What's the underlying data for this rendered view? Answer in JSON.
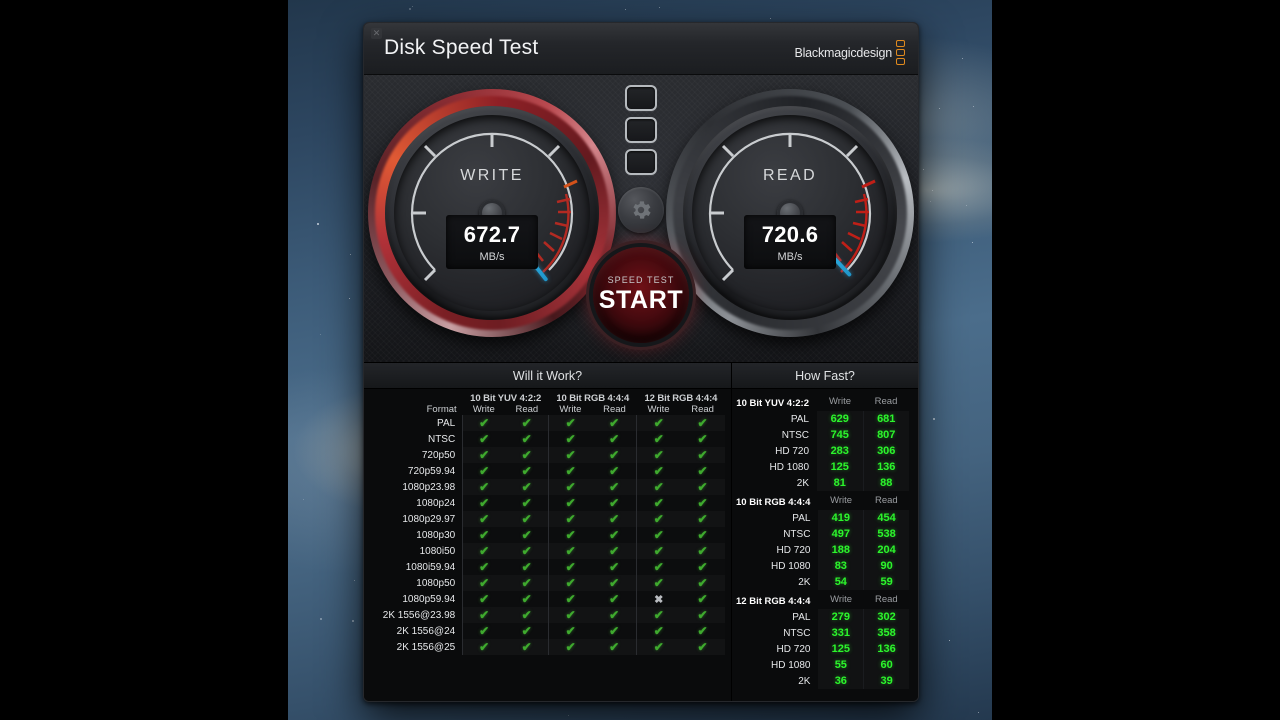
{
  "window": {
    "title": "Disk Speed Test",
    "close_icon": "close-icon",
    "brand": "Blackmagicdesign"
  },
  "gauges": {
    "write": {
      "label": "WRITE",
      "value": "672.7",
      "unit": "MB/s",
      "needle_deg": 52
    },
    "read": {
      "label": "READ",
      "value": "720.6",
      "unit": "MB/s",
      "needle_deg": 47
    }
  },
  "center": {
    "indicator_count": 3,
    "gear_icon": "gear-icon",
    "start_sub": "SPEED TEST",
    "start_main": "START"
  },
  "will_it_work": {
    "heading": "Will it Work?",
    "format_header": "Format",
    "groups": [
      {
        "label": "10 Bit YUV 4:2:2",
        "cols": [
          "Write",
          "Read"
        ]
      },
      {
        "label": "10 Bit RGB 4:4:4",
        "cols": [
          "Write",
          "Read"
        ]
      },
      {
        "label": "12 Bit RGB 4:4:4",
        "cols": [
          "Write",
          "Read"
        ]
      }
    ],
    "check_glyph": "✔",
    "cross_glyph": "✖",
    "rows": [
      {
        "format": "PAL",
        "cells": [
          true,
          true,
          true,
          true,
          true,
          true
        ]
      },
      {
        "format": "NTSC",
        "cells": [
          true,
          true,
          true,
          true,
          true,
          true
        ]
      },
      {
        "format": "720p50",
        "cells": [
          true,
          true,
          true,
          true,
          true,
          true
        ]
      },
      {
        "format": "720p59.94",
        "cells": [
          true,
          true,
          true,
          true,
          true,
          true
        ]
      },
      {
        "format": "1080p23.98",
        "cells": [
          true,
          true,
          true,
          true,
          true,
          true
        ]
      },
      {
        "format": "1080p24",
        "cells": [
          true,
          true,
          true,
          true,
          true,
          true
        ]
      },
      {
        "format": "1080p29.97",
        "cells": [
          true,
          true,
          true,
          true,
          true,
          true
        ]
      },
      {
        "format": "1080p30",
        "cells": [
          true,
          true,
          true,
          true,
          true,
          true
        ]
      },
      {
        "format": "1080i50",
        "cells": [
          true,
          true,
          true,
          true,
          true,
          true
        ]
      },
      {
        "format": "1080i59.94",
        "cells": [
          true,
          true,
          true,
          true,
          true,
          true
        ]
      },
      {
        "format": "1080p50",
        "cells": [
          true,
          true,
          true,
          true,
          true,
          true
        ]
      },
      {
        "format": "1080p59.94",
        "cells": [
          true,
          true,
          true,
          true,
          false,
          true
        ]
      },
      {
        "format": "2K 1556@23.98",
        "cells": [
          true,
          true,
          true,
          true,
          true,
          true
        ]
      },
      {
        "format": "2K 1556@24",
        "cells": [
          true,
          true,
          true,
          true,
          true,
          true
        ]
      },
      {
        "format": "2K 1556@25",
        "cells": [
          true,
          true,
          true,
          true,
          true,
          true
        ]
      }
    ]
  },
  "how_fast": {
    "heading": "How Fast?",
    "col_write": "Write",
    "col_read": "Read",
    "sections": [
      {
        "label": "10 Bit YUV 4:2:2",
        "rows": [
          {
            "name": "PAL",
            "write": "629",
            "read": "681"
          },
          {
            "name": "NTSC",
            "write": "745",
            "read": "807"
          },
          {
            "name": "HD 720",
            "write": "283",
            "read": "306"
          },
          {
            "name": "HD 1080",
            "write": "125",
            "read": "136"
          },
          {
            "name": "2K",
            "write": "81",
            "read": "88"
          }
        ]
      },
      {
        "label": "10 Bit RGB 4:4:4",
        "rows": [
          {
            "name": "PAL",
            "write": "419",
            "read": "454"
          },
          {
            "name": "NTSC",
            "write": "497",
            "read": "538"
          },
          {
            "name": "HD 720",
            "write": "188",
            "read": "204"
          },
          {
            "name": "HD 1080",
            "write": "83",
            "read": "90"
          },
          {
            "name": "2K",
            "write": "54",
            "read": "59"
          }
        ]
      },
      {
        "label": "12 Bit RGB 4:4:4",
        "rows": [
          {
            "name": "PAL",
            "write": "279",
            "read": "302"
          },
          {
            "name": "NTSC",
            "write": "331",
            "read": "358"
          },
          {
            "name": "HD 720",
            "write": "125",
            "read": "136"
          },
          {
            "name": "HD 1080",
            "write": "55",
            "read": "60"
          },
          {
            "name": "2K",
            "write": "36",
            "read": "39"
          }
        ]
      }
    ]
  },
  "colors": {
    "accent_green": "#2cf52c",
    "needle_blue": "#35bdf2",
    "brand_orange": "#e08a1e",
    "danger_red": "#b9232b"
  }
}
